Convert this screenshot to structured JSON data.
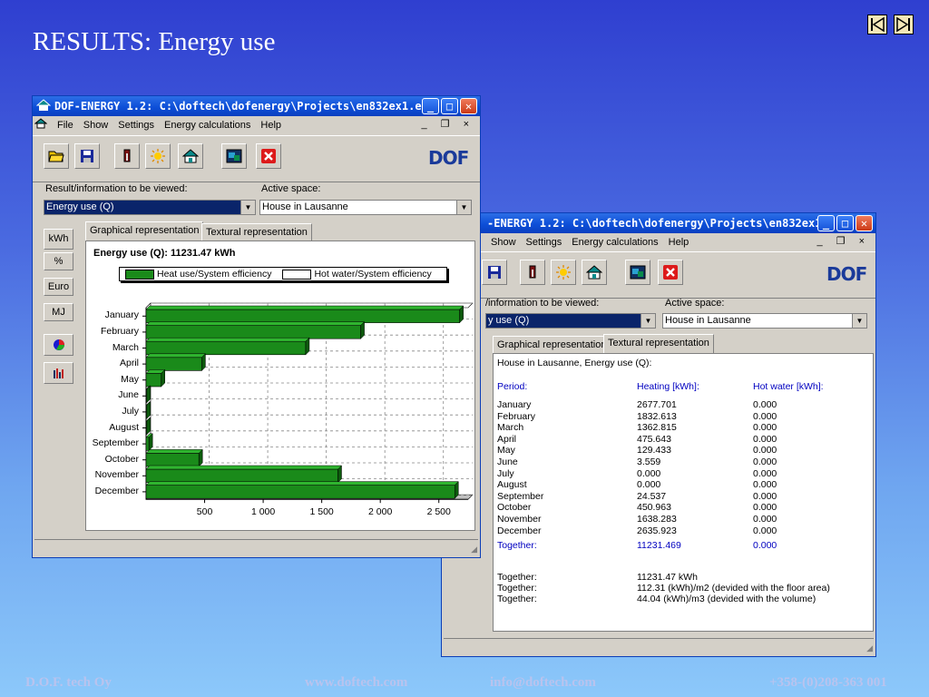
{
  "slide": {
    "title": "RESULTS: Energy use",
    "footer": [
      "D.O.F. tech Oy",
      "www.doftech.com",
      "info@doftech.com",
      "+358-(0)208-363 001"
    ],
    "nav": [
      "first-slide-icon",
      "next-slide-icon"
    ]
  },
  "window1": {
    "title": "DOF-ENERGY 1.2: C:\\doftech\\dofenergy\\Projects\\en832ex1.e...",
    "menu": [
      "File",
      "Show",
      "Settings",
      "Energy calculations",
      "Help"
    ],
    "mdi_controls": "_ ❐ ×",
    "result_label": "Result/information to be viewed:",
    "result_value": "Energy use (Q)",
    "space_label": "Active space:",
    "space_value": "House in Lausanne",
    "units": [
      "kWh",
      "%",
      "Euro",
      "MJ"
    ],
    "tabs": [
      "Graphical representation",
      "Textural representation"
    ],
    "logo": "DOF"
  },
  "chart_data": {
    "type": "bar",
    "orientation": "horizontal",
    "title": "Energy use (Q): 11231.47 kWh",
    "legend": [
      "Heat use/System efficiency",
      "Hot water/System efficiency"
    ],
    "legend_position": "top",
    "categories": [
      "January",
      "February",
      "March",
      "April",
      "May",
      "June",
      "July",
      "August",
      "September",
      "October",
      "November",
      "December"
    ],
    "series": [
      {
        "name": "Heat use/System efficiency",
        "color": "#1a8a1a",
        "values": [
          2677.701,
          1832.613,
          1362.815,
          475.643,
          129.433,
          3.559,
          0,
          0,
          24.537,
          450.963,
          1638.283,
          2635.923
        ]
      },
      {
        "name": "Hot water/System efficiency",
        "color": "#ffffff",
        "values": [
          0,
          0,
          0,
          0,
          0,
          0,
          0,
          0,
          0,
          0,
          0,
          0
        ]
      }
    ],
    "xticks": [
      "500",
      "1 000",
      "1 500",
      "2 000",
      "2 500"
    ],
    "xlim": [
      0,
      2750
    ],
    "grid": true
  },
  "window2": {
    "title": "-ENERGY 1.2: C:\\doftech\\dofenergy\\Projects\\en832ex1.e...",
    "menu": [
      "Show",
      "Settings",
      "Energy calculations",
      "Help"
    ],
    "mdi_controls": "_ ❐ ×",
    "result_label": "/information to be viewed:",
    "result_value": "y use (Q)",
    "space_label": "Active space:",
    "space_value": "House in Lausanne",
    "tabs": [
      "Graphical representation",
      "Textural representation"
    ],
    "text_header": "House in Lausanne, Energy use (Q):",
    "columns": [
      "Period:",
      "Heating [kWh]:",
      "Hot water [kWh]:"
    ],
    "rows": [
      [
        "January",
        "2677.701",
        "0.000"
      ],
      [
        "February",
        "1832.613",
        "0.000"
      ],
      [
        "March",
        "1362.815",
        "0.000"
      ],
      [
        "April",
        "475.643",
        "0.000"
      ],
      [
        "May",
        "129.433",
        "0.000"
      ],
      [
        "June",
        "3.559",
        "0.000"
      ],
      [
        "July",
        "0.000",
        "0.000"
      ],
      [
        "August",
        "0.000",
        "0.000"
      ],
      [
        "September",
        "24.537",
        "0.000"
      ],
      [
        "October",
        "450.963",
        "0.000"
      ],
      [
        "November",
        "1638.283",
        "0.000"
      ],
      [
        "December",
        "2635.923",
        "0.000"
      ]
    ],
    "total": [
      "Together:",
      "11231.469",
      "0.000"
    ],
    "summary": [
      [
        "Together:",
        "11231.47 kWh"
      ],
      [
        "Together:",
        "112.31 (kWh)/m2 (devided with the floor area)"
      ],
      [
        "Together:",
        "44.04 (kWh)/m3 (devided with the volume)"
      ]
    ],
    "logo": "DOF"
  }
}
